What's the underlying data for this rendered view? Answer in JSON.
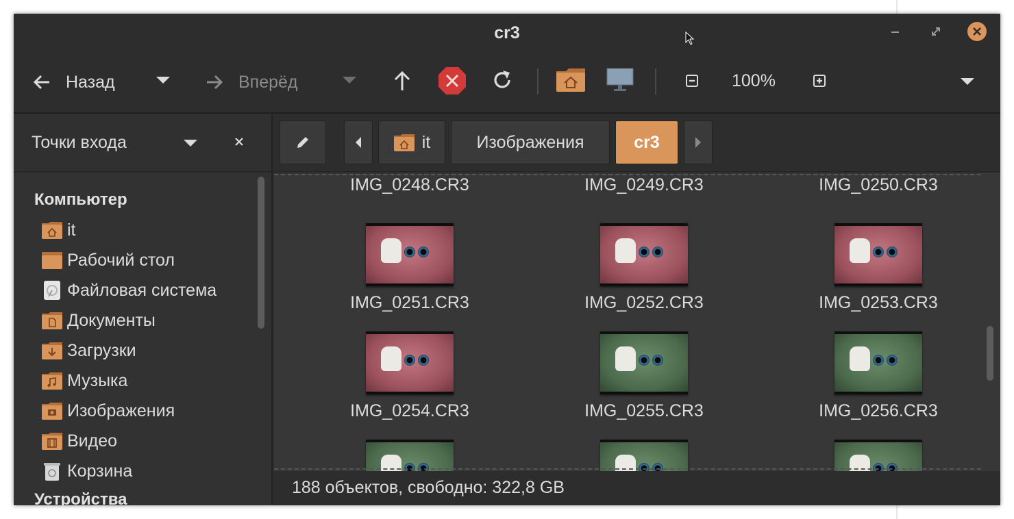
{
  "window": {
    "title": "cr3"
  },
  "toolbar": {
    "back_label": "Назад",
    "forward_label": "Вперёд",
    "zoom_label": "100%"
  },
  "sidebar": {
    "header_label": "Точки входа",
    "section_computer": "Компьютер",
    "section_devices": "Устройства",
    "items": [
      {
        "label": "it",
        "icon": "home-folder-icon"
      },
      {
        "label": "Рабочий стол",
        "icon": "desktop-folder-icon"
      },
      {
        "label": "Файловая система",
        "icon": "drive-icon"
      },
      {
        "label": "Документы",
        "icon": "documents-folder-icon"
      },
      {
        "label": "Загрузки",
        "icon": "downloads-folder-icon"
      },
      {
        "label": "Музыка",
        "icon": "music-folder-icon"
      },
      {
        "label": "Изображения",
        "icon": "pictures-folder-icon"
      },
      {
        "label": "Видео",
        "icon": "videos-folder-icon"
      },
      {
        "label": "Корзина",
        "icon": "trash-icon"
      }
    ]
  },
  "pathbar": {
    "crumbs": [
      "it",
      "Изображения",
      "cr3"
    ]
  },
  "files": {
    "row0": [
      "IMG_0248.CR3",
      "IMG_0249.CR3",
      "IMG_0250.CR3"
    ],
    "row1": [
      "IMG_0251.CR3",
      "IMG_0252.CR3",
      "IMG_0253.CR3"
    ],
    "row2": [
      "IMG_0254.CR3",
      "IMG_0255.CR3",
      "IMG_0256.CR3"
    ]
  },
  "status": {
    "text": "188 объектов, свободно: 322,8 GB"
  },
  "colors": {
    "accent": "#d9955a",
    "window_bg": "#2d2d2d",
    "content_bg": "#373737"
  }
}
